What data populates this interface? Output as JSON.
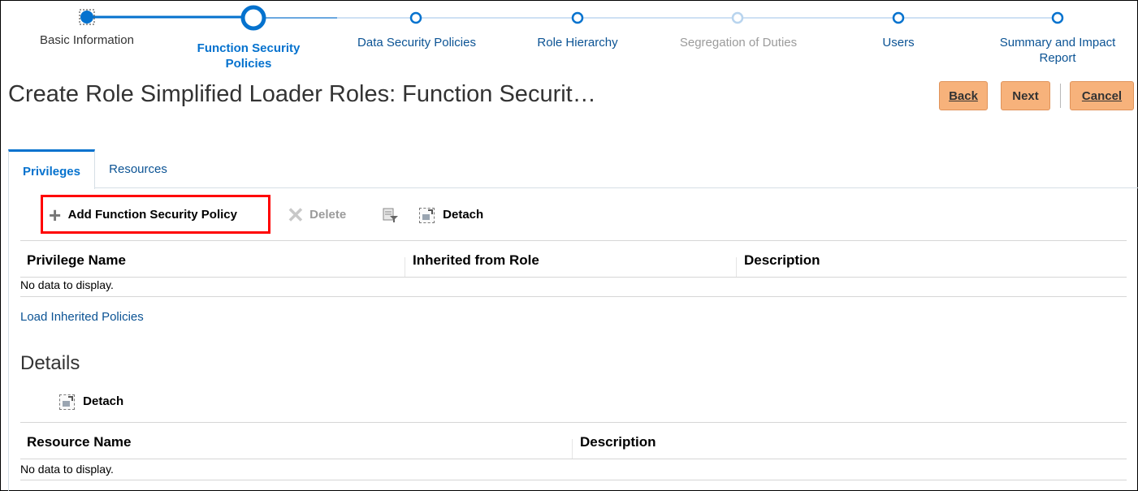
{
  "train": {
    "stops": [
      {
        "label": "Basic Information",
        "state": "done"
      },
      {
        "label": "Function Security Policies",
        "state": "current"
      },
      {
        "label": "Data Security Policies",
        "state": "next"
      },
      {
        "label": "Role Hierarchy",
        "state": "next"
      },
      {
        "label": "Segregation of Duties",
        "state": "disabled"
      },
      {
        "label": "Users",
        "state": "next"
      },
      {
        "label": "Summary and Impact Report",
        "state": "next"
      }
    ]
  },
  "page": {
    "title": "Create Role Simplified Loader Roles: Function Securit…"
  },
  "actions": {
    "back": "Back",
    "next": "Next",
    "cancel": "Cancel"
  },
  "tabs": [
    {
      "label": "Privileges",
      "active": true
    },
    {
      "label": "Resources",
      "active": false
    }
  ],
  "privileges_toolbar": {
    "add": "Add Function Security Policy",
    "delete": "Delete",
    "detach": "Detach"
  },
  "privileges_table": {
    "columns": [
      "Privilege Name",
      "Inherited from Role",
      "Description"
    ],
    "empty_text": "No data to display."
  },
  "load_link": "Load Inherited Policies",
  "details": {
    "title": "Details",
    "detach": "Detach",
    "columns": [
      "Resource Name",
      "Description"
    ],
    "empty_text": "No data to display."
  },
  "colors": {
    "accent": "#0572ce",
    "button": "#f7b27b",
    "highlight": "#ff0000"
  }
}
